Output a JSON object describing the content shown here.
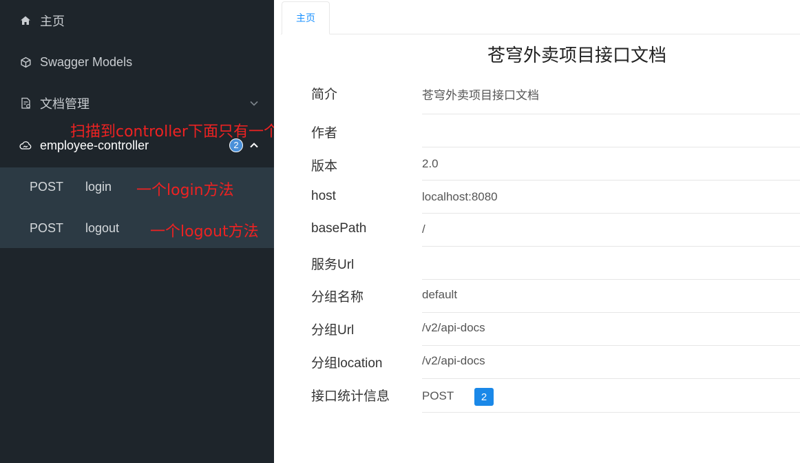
{
  "sidebar": {
    "items": [
      {
        "label": "主页",
        "icon": "home-icon"
      },
      {
        "label": "Swagger Models",
        "icon": "cube-icon"
      },
      {
        "label": "文档管理",
        "icon": "document-settings-icon"
      },
      {
        "label": "employee-controller",
        "icon": "cloud-icon",
        "badge": "2"
      }
    ],
    "submenu": [
      {
        "method": "POST",
        "path": "login"
      },
      {
        "method": "POST",
        "path": "logout"
      }
    ]
  },
  "annotations": {
    "controller_note": "扫描到controller下面只有一个",
    "login_note": "一个login方法",
    "logout_note": "一个logout方法"
  },
  "main": {
    "tab_label": "主页",
    "title": "苍穹外卖项目接口文档",
    "info": [
      {
        "label": "简介",
        "value": "苍穹外卖项目接口文档"
      },
      {
        "label": "作者",
        "value": ""
      },
      {
        "label": "版本",
        "value": "2.0"
      },
      {
        "label": "host",
        "value": "localhost:8080"
      },
      {
        "label": "basePath",
        "value": "/"
      },
      {
        "label": "服务Url",
        "value": ""
      },
      {
        "label": "分组名称",
        "value": "default"
      },
      {
        "label": "分组Url",
        "value": "/v2/api-docs"
      },
      {
        "label": "分组location",
        "value": "/v2/api-docs"
      },
      {
        "label": "接口统计信息",
        "value": "POST"
      }
    ],
    "stats_count": "2"
  },
  "colors": {
    "sidebar_bg": "#1e252b",
    "submenu_bg": "#2c3a44",
    "accent": "#1890ff",
    "annotation": "#ee2222"
  }
}
